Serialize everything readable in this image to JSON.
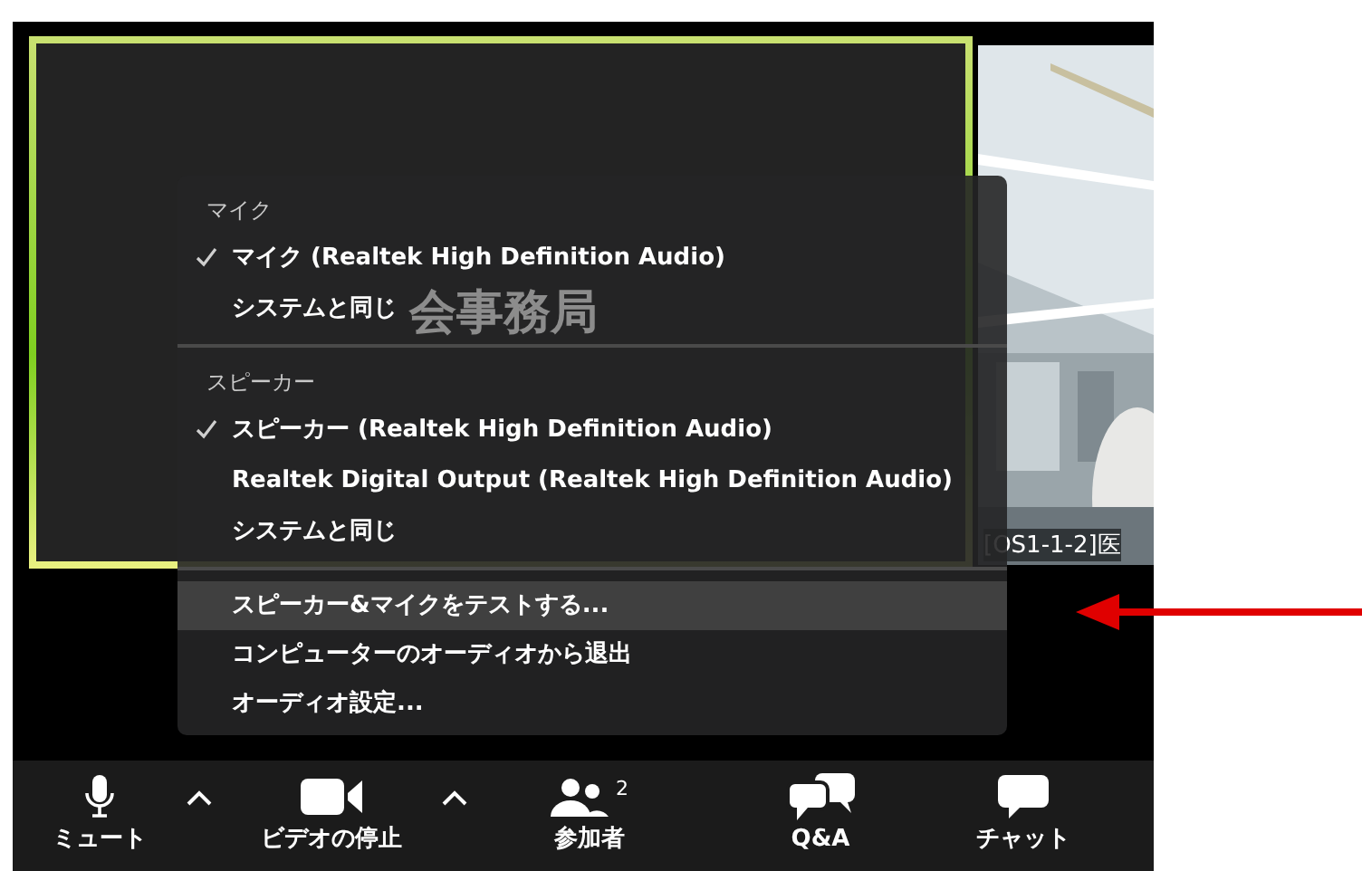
{
  "video_tiles": [
    {
      "kind": "speaker",
      "name": "会事務局",
      "highlighted": true
    },
    {
      "kind": "picture",
      "name": "[OS1-1-2]医",
      "highlighted": false
    }
  ],
  "audio_menu": {
    "sections": [
      {
        "header": "マイク",
        "items": [
          {
            "label": "マイク (Realtek High Definition Audio)",
            "selected": true
          },
          {
            "label": "システムと同じ",
            "selected": false
          }
        ]
      },
      {
        "header": "スピーカー",
        "items": [
          {
            "label": "スピーカー (Realtek High Definition Audio)",
            "selected": true
          },
          {
            "label": "Realtek Digital Output (Realtek High Definition Audio)",
            "selected": false
          },
          {
            "label": "システムと同じ",
            "selected": false
          }
        ]
      }
    ],
    "actions": [
      {
        "label": "スピーカー&マイクをテストする...",
        "highlighted": true
      },
      {
        "label": "コンピューターのオーディオから退出",
        "highlighted": false
      },
      {
        "label": "オーディオ設定...",
        "highlighted": false
      }
    ]
  },
  "toolbar": [
    {
      "kind": "mic",
      "label": "ミュート",
      "caret": true
    },
    {
      "kind": "video",
      "label": "ビデオの停止",
      "caret": true
    },
    {
      "kind": "participants",
      "label": "参加者",
      "badge": "2"
    },
    {
      "kind": "qa",
      "label": "Q&A"
    },
    {
      "kind": "chat",
      "label": "チャット"
    }
  ]
}
